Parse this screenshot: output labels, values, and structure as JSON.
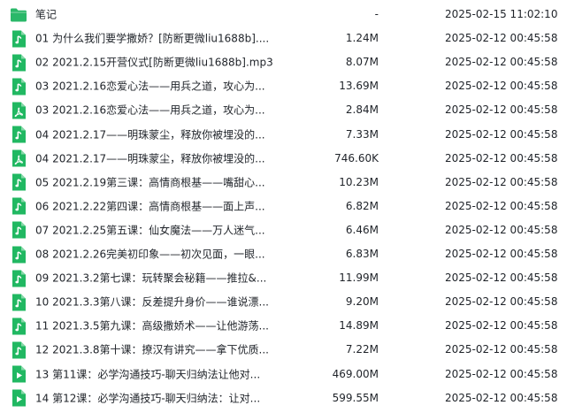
{
  "colors": {
    "icon_green": "#21b862",
    "folder": "#2ab869",
    "text": "#1f2329"
  },
  "files": [
    {
      "icon": "folder-icon",
      "name": "笔记",
      "size": "-",
      "date": "2025-02-15 11:02:10"
    },
    {
      "icon": "audio-file-icon",
      "name": "01 为什么我们要学撒娇？[防断更微liu1688b]....",
      "size": "1.24M",
      "date": "2025-02-12 00:45:58"
    },
    {
      "icon": "audio-file-icon",
      "name": "02 2021.2.15开营仪式[防断更微liu1688b].mp3",
      "size": "8.07M",
      "date": "2025-02-12 00:45:58"
    },
    {
      "icon": "audio-file-icon",
      "name": "03 2021.2.16恋爱心法——用兵之道，攻心为...",
      "size": "13.69M",
      "date": "2025-02-12 00:45:58"
    },
    {
      "icon": "pdf-file-icon",
      "name": "03 2021.2.16恋爱心法——用兵之道，攻心为...",
      "size": "2.84M",
      "date": "2025-02-12 00:45:58"
    },
    {
      "icon": "audio-file-icon",
      "name": "04 2021.2.17——明珠蒙尘，释放你被埋没的...",
      "size": "7.33M",
      "date": "2025-02-12 00:45:58"
    },
    {
      "icon": "pdf-file-icon",
      "name": "04 2021.2.17——明珠蒙尘，释放你被埋没的...",
      "size": "746.60K",
      "date": "2025-02-12 00:45:58"
    },
    {
      "icon": "audio-file-icon",
      "name": "05 2021.2.19第三课：高情商根基——嘴甜心...",
      "size": "10.23M",
      "date": "2025-02-12 00:45:58"
    },
    {
      "icon": "audio-file-icon",
      "name": "06 2021.2.22第四课：高情商根基——面上声...",
      "size": "6.82M",
      "date": "2025-02-12 00:45:58"
    },
    {
      "icon": "audio-file-icon",
      "name": "07 2021.2.25第五课：仙女魔法——万人迷气...",
      "size": "6.46M",
      "date": "2025-02-12 00:45:58"
    },
    {
      "icon": "audio-file-icon",
      "name": "08 2021.2.26完美初印象——初次见面，一眼...",
      "size": "6.83M",
      "date": "2025-02-12 00:45:58"
    },
    {
      "icon": "audio-file-icon",
      "name": "09 2021.3.2第七课：玩转聚会秘籍——推拉&...",
      "size": "11.99M",
      "date": "2025-02-12 00:45:58"
    },
    {
      "icon": "audio-file-icon",
      "name": "10 2021.3.3第八课：反差提升身价——谁说漂...",
      "size": "9.20M",
      "date": "2025-02-12 00:45:58"
    },
    {
      "icon": "audio-file-icon",
      "name": "11 2021.3.5第九课：高级撒娇术——让他游荡...",
      "size": "14.89M",
      "date": "2025-02-12 00:45:58"
    },
    {
      "icon": "audio-file-icon",
      "name": "12 2021.3.8第十课：撩汉有讲究——拿下优质...",
      "size": "7.22M",
      "date": "2025-02-12 00:45:58"
    },
    {
      "icon": "video-file-icon",
      "name": "13 第11课：必学沟通技巧-聊天归纳法让他对...",
      "size": "469.00M",
      "date": "2025-02-12 00:45:58"
    },
    {
      "icon": "video-file-icon",
      "name": "14 第12课：必学沟通技巧-聊天归纳法：让对...",
      "size": "599.55M",
      "date": "2025-02-12 00:45:58"
    }
  ]
}
